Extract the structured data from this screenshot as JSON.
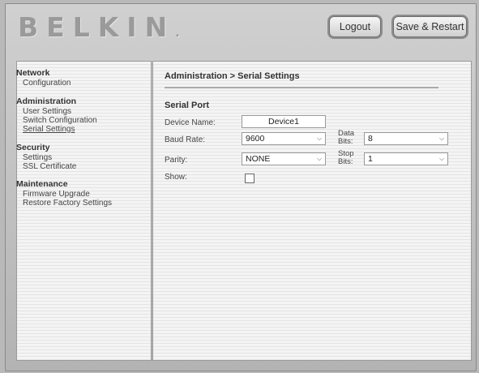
{
  "brand": {
    "logo": "BELKIN",
    "logo_dot": "."
  },
  "header": {
    "logout_label": "Logout",
    "save_restart_label": "Save & Restart"
  },
  "sidebar": {
    "network": {
      "heading": "Network",
      "items": [
        "Configuration"
      ]
    },
    "administration": {
      "heading": "Administration",
      "items": [
        "User Settings",
        "Switch Configuration",
        "Serial Settings"
      ]
    },
    "security": {
      "heading": "Security",
      "items": [
        "Settings",
        "SSL Certificate"
      ]
    },
    "maintenance": {
      "heading": "Maintenance",
      "items": [
        "Firmware Upgrade",
        "Restore Factory Settings"
      ]
    }
  },
  "main": {
    "breadcrumb": "Administration > Serial Settings",
    "section": "Serial Port",
    "device_name": {
      "label": "Device Name:",
      "value": "Device1"
    },
    "baud_rate": {
      "label": "Baud Rate:",
      "value": "9600"
    },
    "data_bits": {
      "label_line1": "Data",
      "label_line2": "Bits:",
      "value": "8"
    },
    "parity": {
      "label": "Parity:",
      "value": "NONE"
    },
    "stop_bits": {
      "label_line1": "Stop",
      "label_line2": "Bits:",
      "value": "1"
    },
    "show": {
      "label": "Show:",
      "checked": false
    }
  }
}
